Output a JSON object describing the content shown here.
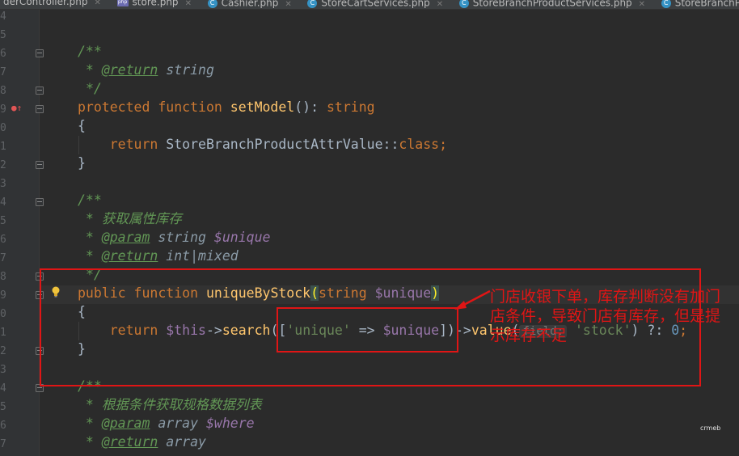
{
  "tabs": [
    {
      "label": "derController.php",
      "icon": "none"
    },
    {
      "label": "store.php",
      "icon": "php-file-icon"
    },
    {
      "label": "Cashier.php",
      "icon": "class-icon"
    },
    {
      "label": "StoreCartServices.php",
      "icon": "class-icon"
    },
    {
      "label": "StoreBranchProductServices.php",
      "icon": "class-icon"
    },
    {
      "label": "StoreBranchProductA",
      "icon": "class-icon"
    }
  ],
  "gutter": {
    "line_numbers": [
      "4",
      "5",
      "6",
      "7",
      "8",
      "9",
      "0",
      "1",
      "2",
      "3",
      "4",
      "5",
      "6",
      "7",
      "8",
      "9",
      "0",
      "1",
      "2",
      "3",
      "4",
      "5",
      "6",
      "7"
    ]
  },
  "code": {
    "l_doc_open": "/**",
    "l_ret_tag": "@return",
    "l_ret_type": "string",
    "l_doc_close": "*/",
    "l_protected": "protected",
    "l_function": "function",
    "l_setmodel": "setModel",
    "l_setmodel_rest": "(): ",
    "l_string": "string",
    "l_brace_open": "{",
    "l_return": "return",
    "l_class_ref": "StoreBranchProductAttrValue::",
    "l_class_kw": "class",
    "l_semicolon": ";",
    "l_brace_close": "}",
    "d2_open": "/**",
    "d2_desc": "获取属性库存",
    "d2_param_tag": "@param",
    "d2_param_type": "string",
    "d2_param_var": "$unique",
    "d2_ret_tag": "@return",
    "d2_ret_type": "int|mixed",
    "d2_close": "*/",
    "m_public": "public",
    "m_function": "function",
    "m_name": "uniqueByStock",
    "m_paren_open": "(",
    "m_param_type": "string",
    "m_param_var": "$unique",
    "m_paren_close": ")",
    "b_open": "{",
    "r_return": "return",
    "r_this": "$this",
    "r_arrow1": "->",
    "r_search": "search",
    "r_lparen": "(",
    "r_lbracket": "[",
    "r_key": "'unique'",
    "r_fatarrow": " => ",
    "r_val": "$unique",
    "r_rbracket": "]",
    "r_rparen": ")",
    "r_arrow2": "->",
    "r_value": "value",
    "r_vlparen": "(",
    "r_hint": "field:",
    "r_stock": "'stock'",
    "r_vrparen": ")",
    "r_elvis": " ?: ",
    "r_zero": "0",
    "r_semi": ";",
    "b_close": "}",
    "d3_open": "/**",
    "d3_desc": "根据条件获取规格数据列表",
    "d3_param_tag": "@param",
    "d3_param_type": "array",
    "d3_param_var": "$where",
    "d3_ret_tag": "@return",
    "d3_ret_type": "array"
  },
  "annotation": {
    "text": "门店收银下单，库存判断没有加门店条件，导致门店有库存，但是提示库存不足"
  },
  "watermark": "crmeb",
  "colors": {
    "annotation_red": "#e01515",
    "editor_bg": "#2b2b2b",
    "keyword": "#cc7832",
    "function": "#ffc66d",
    "string": "#6a8759",
    "comment": "#629755",
    "variable": "#9876aa"
  }
}
